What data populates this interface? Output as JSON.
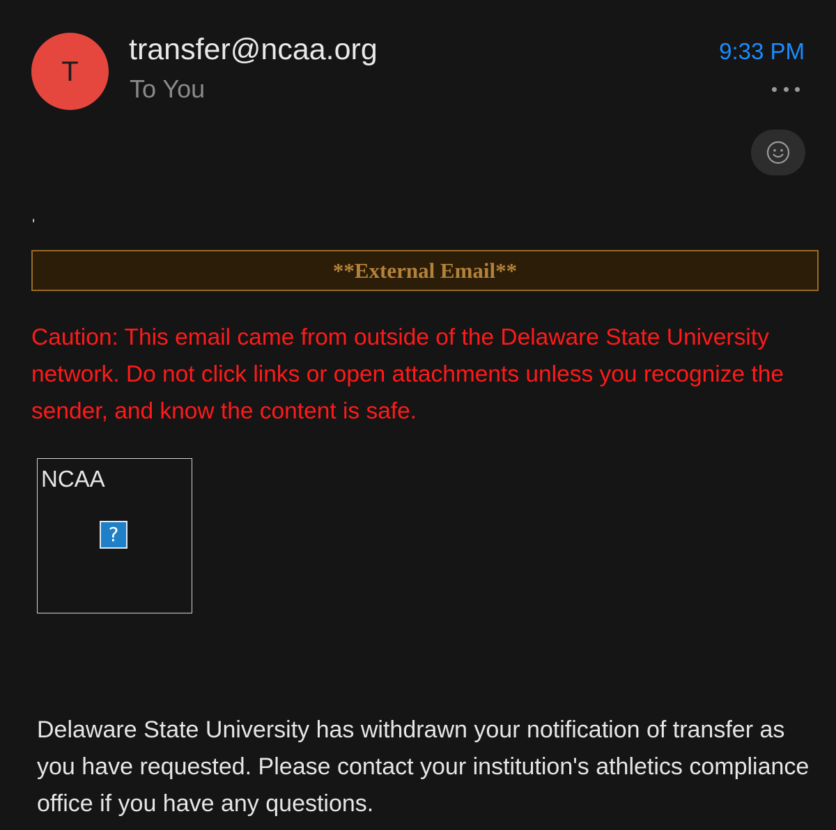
{
  "header": {
    "avatar_initial": "T",
    "sender": "transfer@ncaa.org",
    "recipient": "To You",
    "time": "9:33 PM",
    "more_icon": "more-horizontal-icon",
    "reaction_icon": "smiley-icon"
  },
  "message": {
    "stray_mark": "'",
    "external_banner": "**External Email**",
    "caution_text": "Caution: This email came from outside of the Delaware State University network. Do not click links or open attachments unless you recognize the sender, and know the content is safe.",
    "logo_alt": "NCAA",
    "logo_icon": "broken-image-icon",
    "body": "Delaware State University has withdrawn your notification of transfer as you have requested. Please contact your institution's athletics compliance office if you have any questions."
  },
  "colors": {
    "background": "#151515",
    "avatar": "#e5473f",
    "time": "#1a8cff",
    "caution": "#ff1a1a",
    "banner_border": "#9a6b22",
    "banner_text": "#b3823a"
  }
}
